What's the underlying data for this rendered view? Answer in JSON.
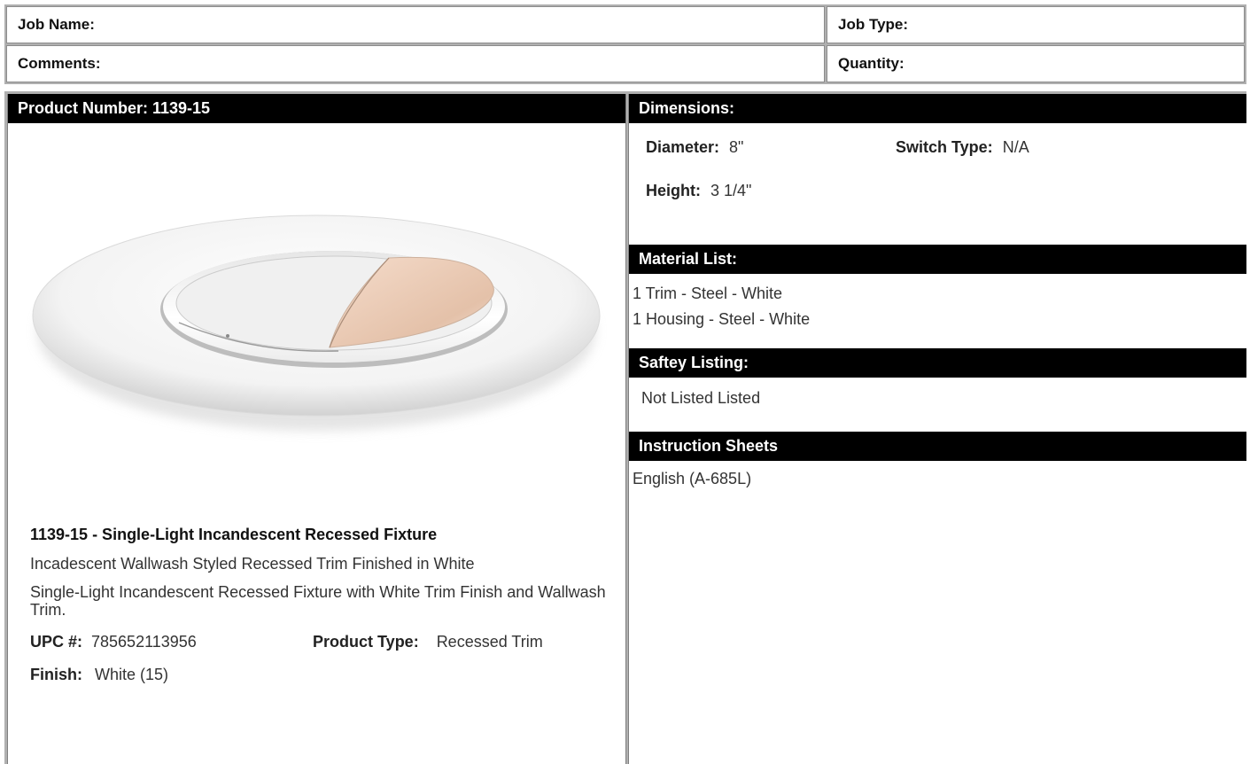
{
  "job": {
    "job_name_label": "Job Name:",
    "job_type_label": "Job Type:",
    "comments_label": "Comments:",
    "quantity_label": "Quantity:"
  },
  "product": {
    "header": "Product Number: 1139-15",
    "title": "1139-15 - Single-Light Incandescent Recessed Fixture",
    "short_desc": "Incadescent Wallwash Styled Recessed Trim Finished in White",
    "long_desc": "Single-Light Incandescent Recessed Fixture with White Trim Finish and Wallwash Trim.",
    "upc_label": "UPC #:",
    "upc_value": "785652113956",
    "type_label": "Product Type:",
    "type_value": "Recessed Trim",
    "finish_label": "Finish:",
    "finish_value": "White (15)"
  },
  "dimensions": {
    "header": "Dimensions:",
    "diameter_label": "Diameter:",
    "diameter_value": "8\"",
    "switch_label": "Switch Type:",
    "switch_value": "N/A",
    "height_label": "Height:",
    "height_value": "3 1/4\""
  },
  "materials": {
    "header": "Material List:",
    "items": [
      "1 Trim - Steel - White",
      "1 Housing - Steel - White"
    ]
  },
  "safety": {
    "header": "Saftey Listing:",
    "value": "Not Listed Listed"
  },
  "instructions": {
    "header": "Instruction Sheets",
    "link": "English (A-685L)"
  },
  "colors": {
    "header_bg": "#000000",
    "trim_accent": "#e9c9b5"
  }
}
